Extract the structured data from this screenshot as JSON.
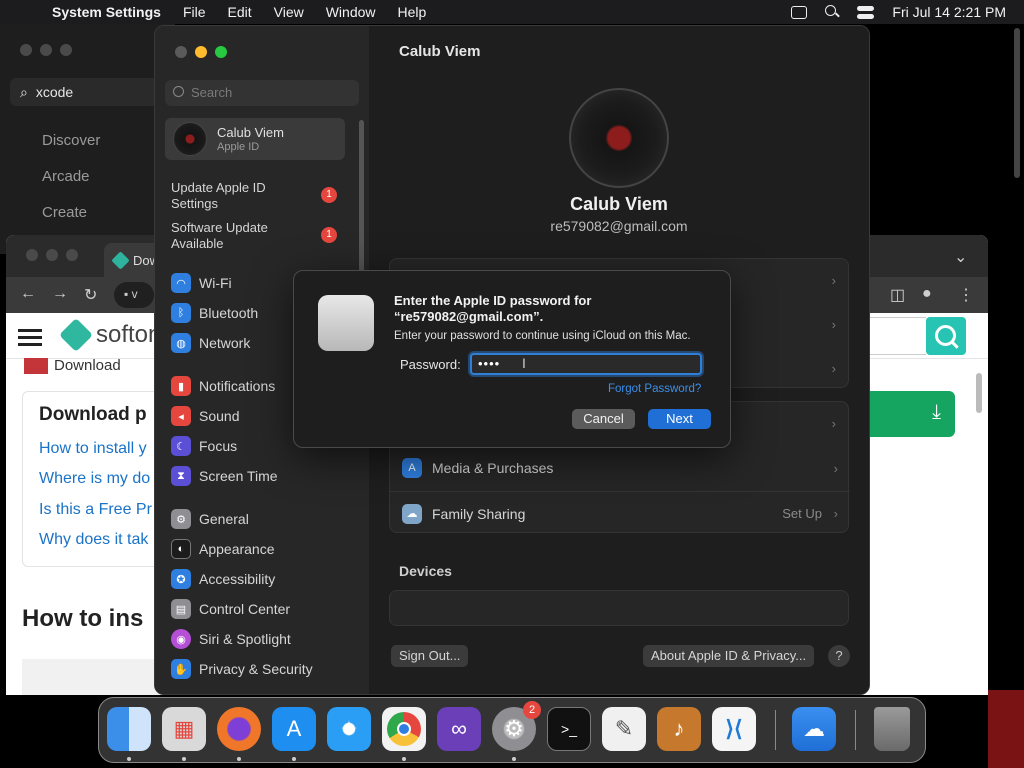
{
  "menubar": {
    "app_name": "System Settings",
    "items": [
      "File",
      "Edit",
      "View",
      "Window",
      "Help"
    ],
    "datetime": "Fri Jul 14  2:21 PM"
  },
  "appstore": {
    "search_value": "xcode",
    "nav": [
      "Discover",
      "Arcade",
      "Create"
    ]
  },
  "chrome": {
    "tab_label": "Dow",
    "url_text": "v",
    "site_logo_text": "softon",
    "download_small": "Download",
    "faq_title": "Download p",
    "faq_links": [
      "How to install y",
      "Where is my do",
      "Is this a Free Pr",
      "Why does it tak"
    ],
    "howto_heading": "How to ins"
  },
  "settings": {
    "search_placeholder": "Search",
    "account": {
      "name": "Calub Viem",
      "sub": "Apple ID"
    },
    "alerts": [
      {
        "label": "Update Apple ID Settings",
        "count": "1"
      },
      {
        "label": "Software Update Available",
        "count": "1"
      }
    ],
    "sidebar_items": [
      {
        "label": "Wi-Fi",
        "icon": "wifi-icon",
        "color": "#2f7fe0"
      },
      {
        "label": "Bluetooth",
        "icon": "bluetooth-icon",
        "color": "#2f7fe0"
      },
      {
        "label": "Network",
        "icon": "network-icon",
        "color": "#2f7fe0"
      },
      {
        "label": "Notifications",
        "icon": "notifications-icon",
        "color": "#e5473f"
      },
      {
        "label": "Sound",
        "icon": "sound-icon",
        "color": "#e5473f"
      },
      {
        "label": "Focus",
        "icon": "focus-icon",
        "color": "#5b4fd6"
      },
      {
        "label": "Screen Time",
        "icon": "screen-time-icon",
        "color": "#5b4fd6"
      },
      {
        "label": "General",
        "icon": "general-icon",
        "color": "#8e8e93"
      },
      {
        "label": "Appearance",
        "icon": "appearance-icon",
        "color": "#1c1c1c"
      },
      {
        "label": "Accessibility",
        "icon": "accessibility-icon",
        "color": "#2f7fe0"
      },
      {
        "label": "Control Center",
        "icon": "control-center-icon",
        "color": "#8e8e93"
      },
      {
        "label": "Siri & Spotlight",
        "icon": "siri-icon",
        "color": "#b44fd6"
      },
      {
        "label": "Privacy & Security",
        "icon": "privacy-icon",
        "color": "#2f7fe0"
      }
    ],
    "content": {
      "title": "Calub Viem",
      "name": "Calub Viem",
      "email": "re579082@gmail.com",
      "rows": [
        {
          "label": "Media & Purchases",
          "value": "",
          "icon": "media-purchases-icon",
          "color": "#2f7fe0"
        },
        {
          "label": "Family Sharing",
          "value": "Set Up",
          "icon": "family-sharing-icon",
          "color": "#7fa6c9"
        }
      ],
      "devices_label": "Devices",
      "sign_out": "Sign Out...",
      "about": "About Apple ID & Privacy...",
      "help": "?"
    }
  },
  "dialog": {
    "title": "Enter the Apple ID password for “re579082@gmail.com”.",
    "message": "Enter your password to continue using iCloud on this Mac.",
    "password_label": "Password:",
    "password_value": "••••",
    "forgot": "Forgot Password?",
    "cancel": "Cancel",
    "next": "Next"
  },
  "dock": {
    "apps": [
      {
        "name": "Finder",
        "icon": "finder-icon",
        "color": "#3b8fe8"
      },
      {
        "name": "Launchpad",
        "icon": "launchpad-icon",
        "color": "#d9d9d9"
      },
      {
        "name": "Firefox",
        "icon": "firefox-icon",
        "color": "#f0772a"
      },
      {
        "name": "App Store",
        "icon": "app-store-icon",
        "color": "#1e8ff0"
      },
      {
        "name": "Safari",
        "icon": "safari-icon",
        "color": "#2a9df4"
      },
      {
        "name": "Chrome",
        "icon": "chrome-icon",
        "color": "#e5e5e5"
      },
      {
        "name": "Visual Studio",
        "icon": "visual-studio-icon",
        "color": "#6a3fb8"
      },
      {
        "name": "System Settings",
        "icon": "system-settings-icon",
        "color": "#8e8e93",
        "badge": "2"
      },
      {
        "name": "Terminal",
        "icon": "terminal-icon",
        "color": "#111111"
      },
      {
        "name": "TextEdit",
        "icon": "textedit-icon",
        "color": "#f0f0f0"
      },
      {
        "name": "GarageBand",
        "icon": "garageband-icon",
        "color": "#c6782c"
      },
      {
        "name": "VS Code",
        "icon": "vscode-icon",
        "color": "#f5f5f5"
      },
      {
        "name": "Weather",
        "icon": "weather-icon",
        "color": "#2f7fe0"
      },
      {
        "name": "Trash",
        "icon": "trash-icon",
        "color": "#8e8e93"
      }
    ]
  }
}
